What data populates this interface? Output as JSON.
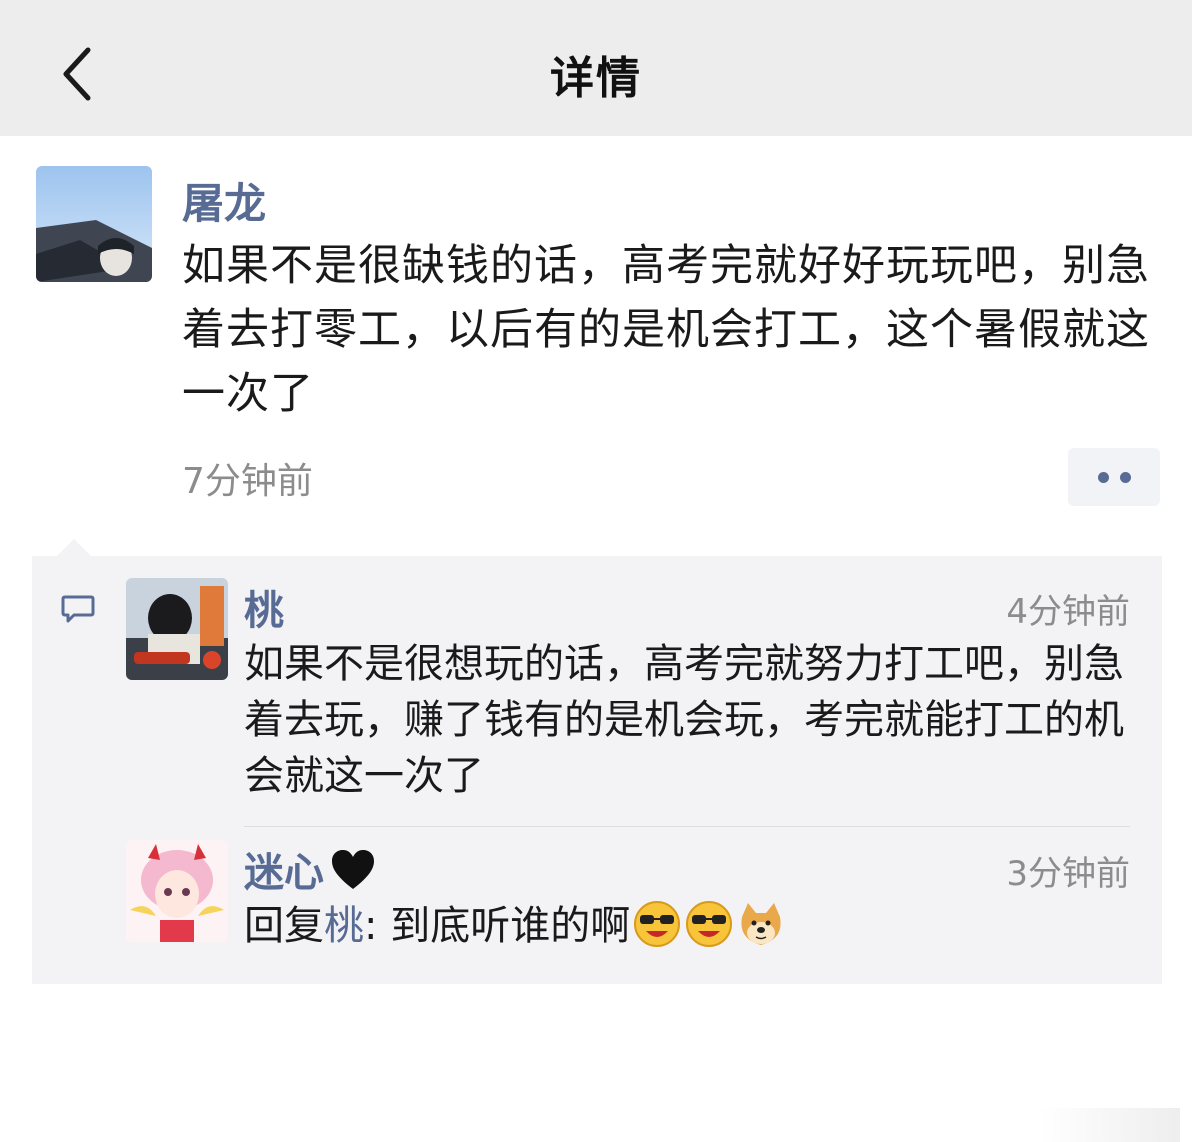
{
  "nav": {
    "title": "详情",
    "back_icon": "chevron-left-icon"
  },
  "post": {
    "author": "屠龙",
    "content": "如果不是很缺钱的话，高考完就好好玩玩吧，别急着去打零工，以后有的是机会打工，这个暑假就这一次了",
    "time": "7分钟前",
    "more_icon": "more-dots-icon"
  },
  "comments": [
    {
      "author": "桃",
      "time": "4分钟前",
      "text": "如果不是很想玩的话，高考完就努力打工吧，别急着去玩，赚了钱有的是机会玩，考完就能打工的机会就这一次了"
    },
    {
      "author": "迷心",
      "author_badge": "black-heart-icon",
      "time": "3分钟前",
      "reply_prefix": "回复",
      "reply_to": "桃",
      "reply_sep": ": ",
      "text": "到底听谁的啊",
      "emojis": [
        "sunglasses-laugh-emoji",
        "sunglasses-laugh-emoji",
        "doge-emoji"
      ]
    }
  ],
  "colors": {
    "nav_bg": "#ededed",
    "link_blue": "#576b95",
    "comment_bg": "#f3f3f5",
    "muted_text": "#8c8c8c"
  }
}
